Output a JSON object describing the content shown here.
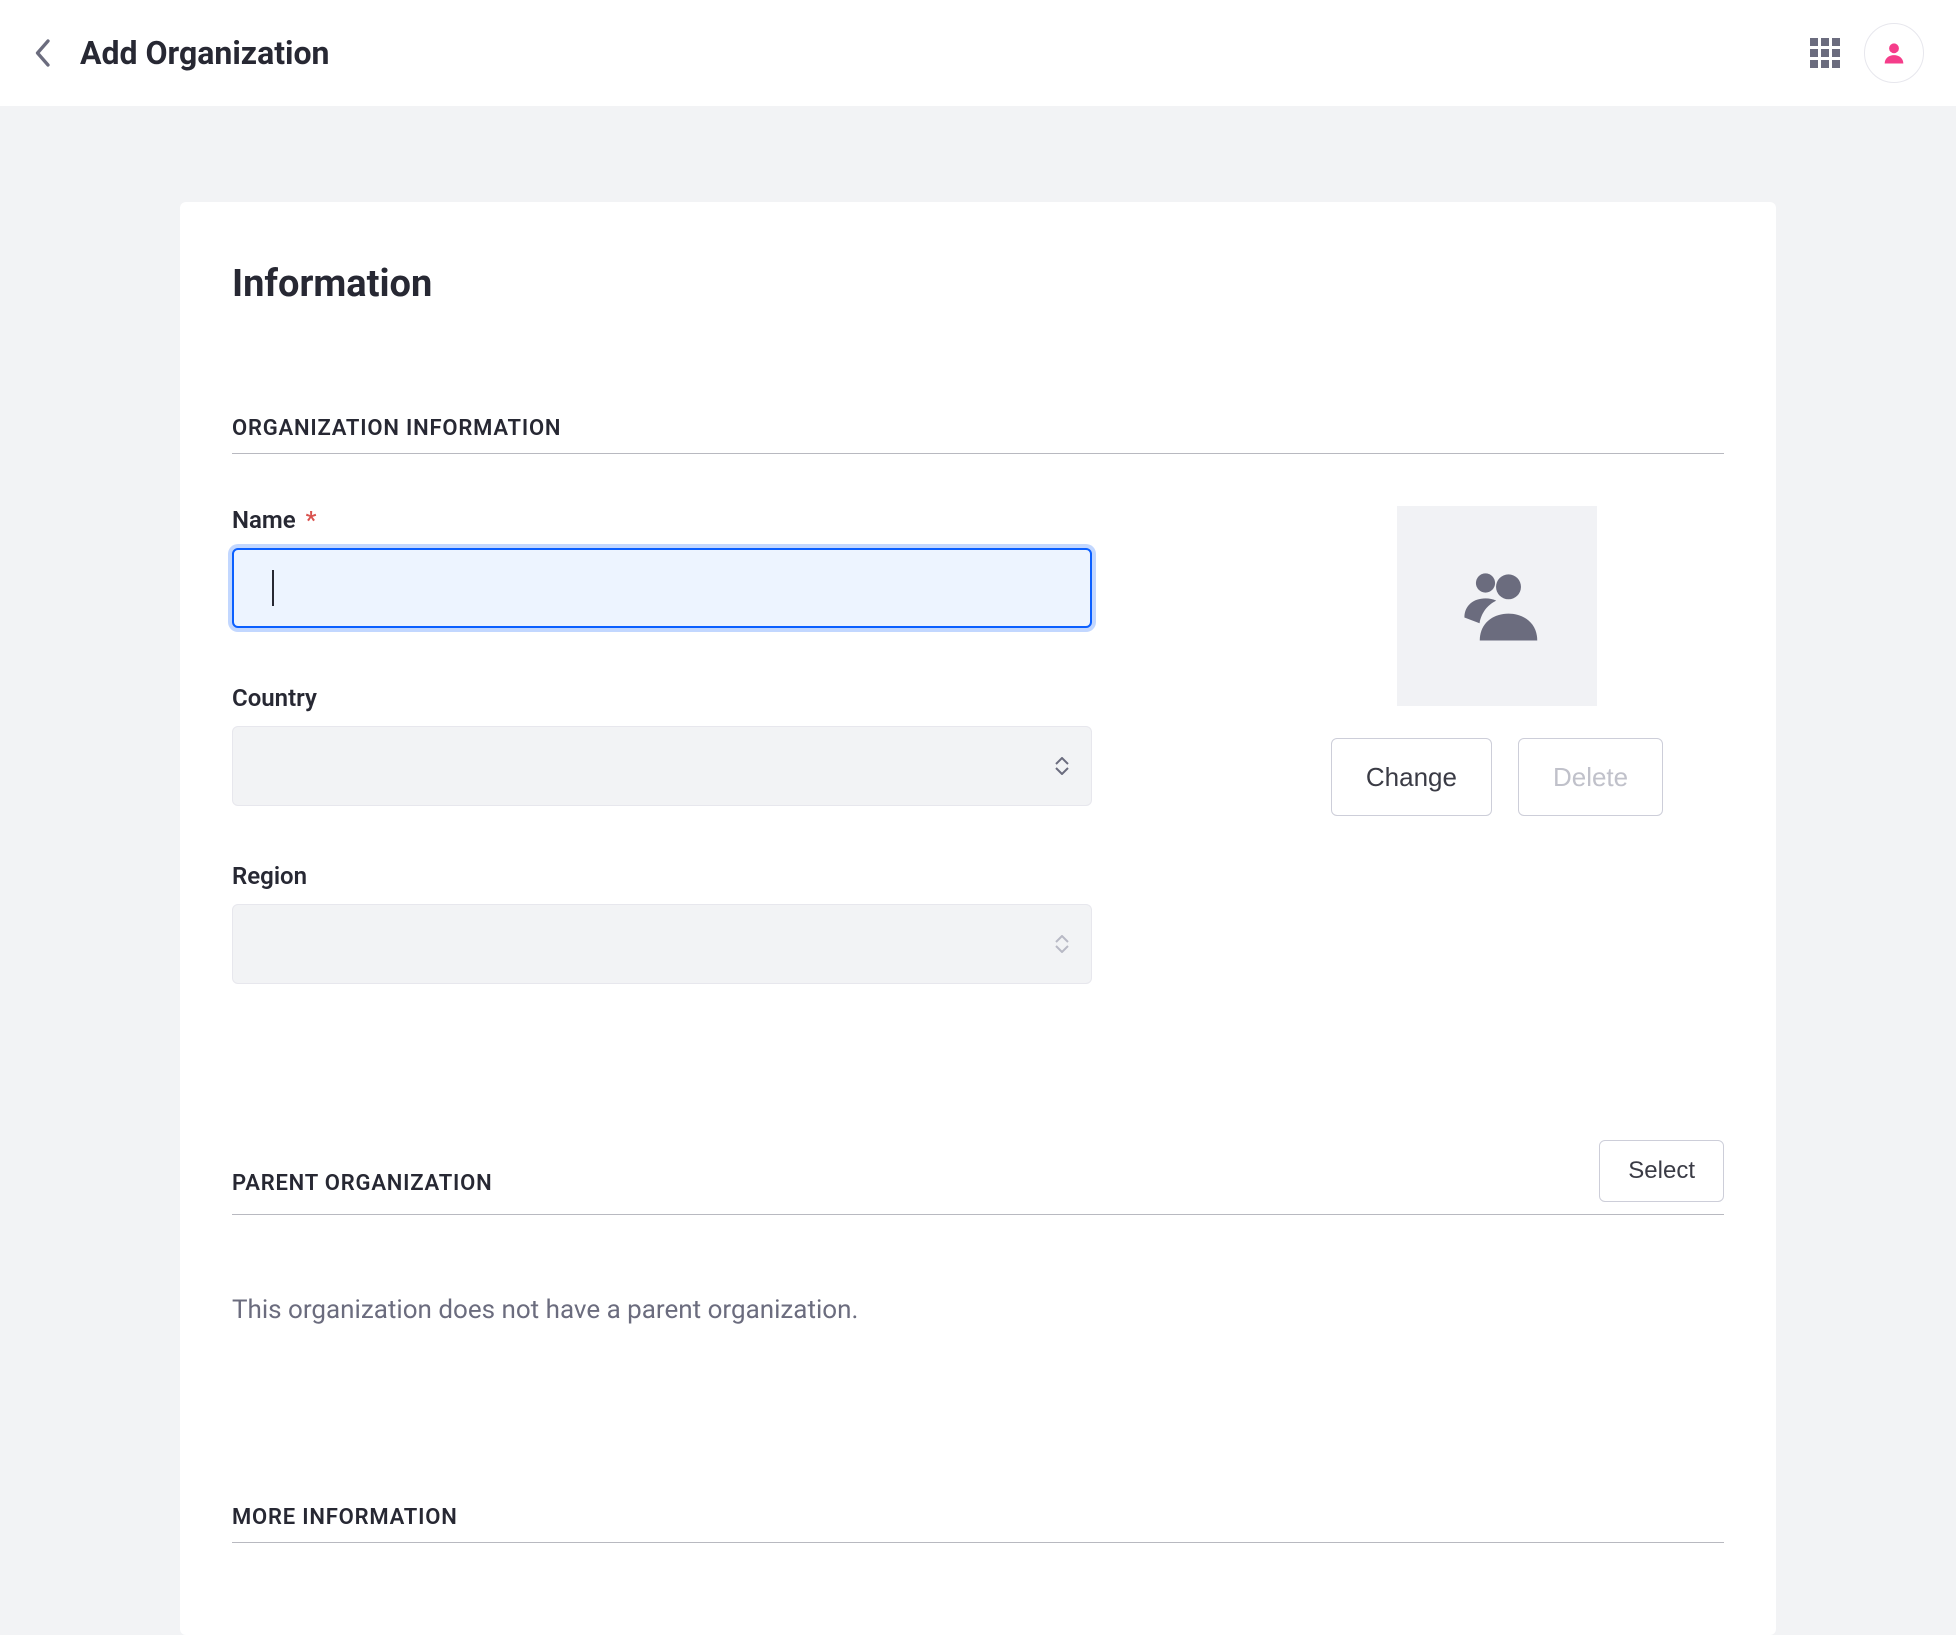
{
  "header": {
    "title": "Add Organization"
  },
  "card": {
    "title": "Information"
  },
  "sections": {
    "org_info_label": "ORGANIZATION INFORMATION",
    "parent_org_label": "PARENT ORGANIZATION",
    "more_info_label": "MORE INFORMATION"
  },
  "fields": {
    "name": {
      "label": "Name",
      "required_marker": "*",
      "value": ""
    },
    "country": {
      "label": "Country",
      "value": ""
    },
    "region": {
      "label": "Region",
      "value": ""
    }
  },
  "avatar_actions": {
    "change": "Change",
    "delete": "Delete"
  },
  "parent_org": {
    "select": "Select",
    "empty_text": "This organization does not have a parent organization."
  }
}
